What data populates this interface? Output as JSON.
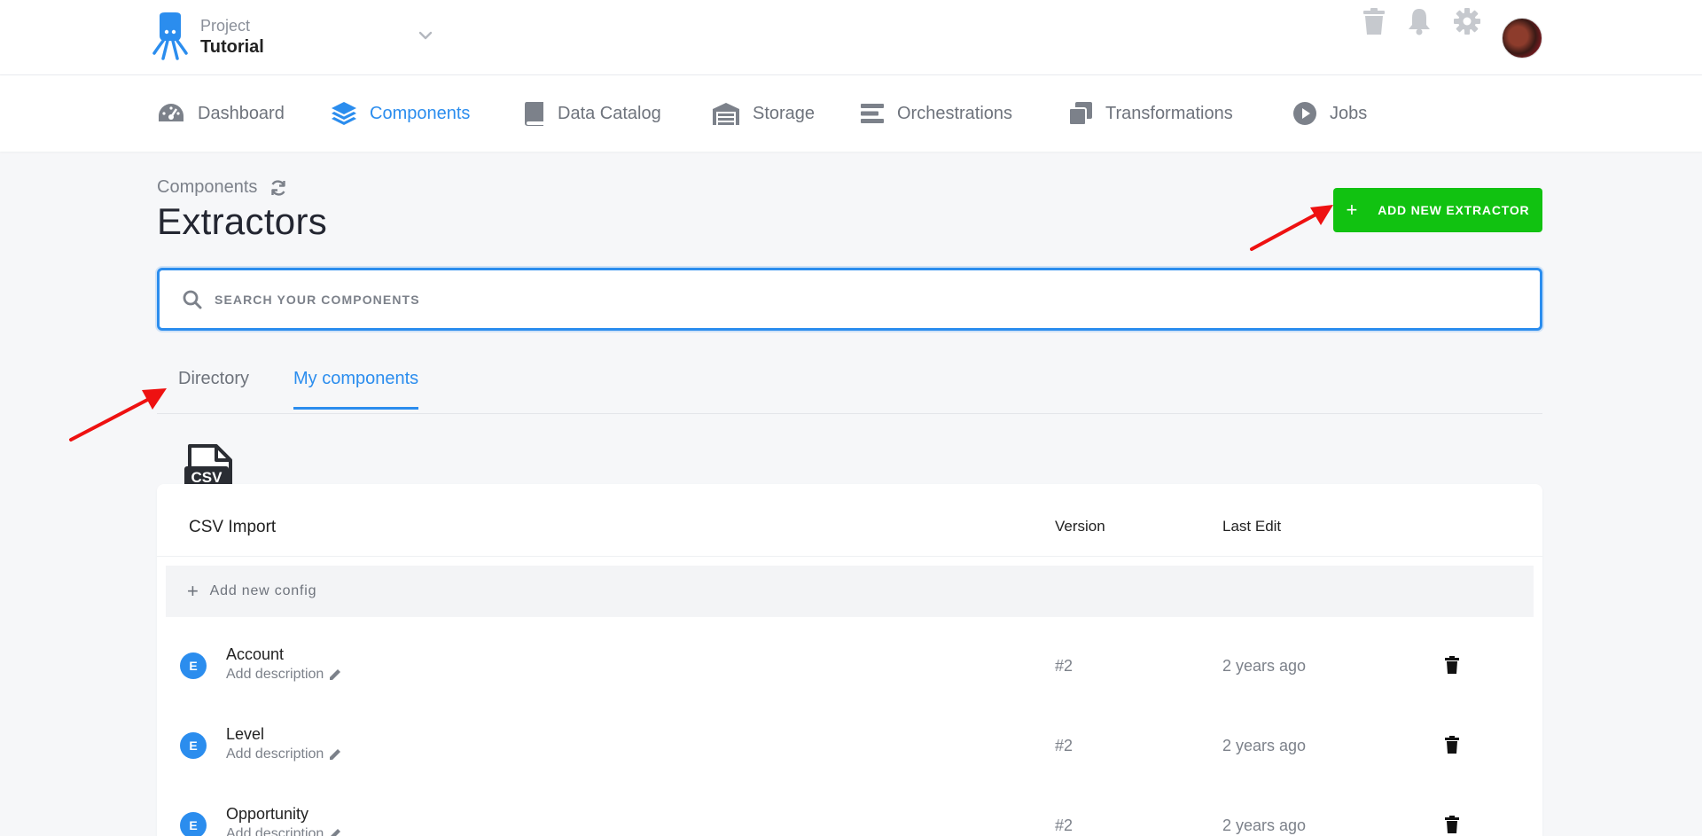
{
  "header": {
    "project_label": "Project",
    "project_name": "Tutorial"
  },
  "nav": [
    {
      "label": "Dashboard",
      "icon": "dashboard-icon",
      "active": false
    },
    {
      "label": "Components",
      "icon": "layers-icon",
      "active": true
    },
    {
      "label": "Data Catalog",
      "icon": "book-icon",
      "active": false
    },
    {
      "label": "Storage",
      "icon": "warehouse-icon",
      "active": false
    },
    {
      "label": "Orchestrations",
      "icon": "bars-icon",
      "active": false
    },
    {
      "label": "Transformations",
      "icon": "copy-icon",
      "active": false
    },
    {
      "label": "Jobs",
      "icon": "play-circle-icon",
      "active": false
    }
  ],
  "page": {
    "breadcrumb": "Components",
    "title": "Extractors",
    "add_button": "ADD NEW EXTRACTOR"
  },
  "search": {
    "placeholder": "SEARCH YOUR COMPONENTS",
    "value": ""
  },
  "tabs": [
    {
      "label": "Directory",
      "active": false
    },
    {
      "label": "My components",
      "active": true
    }
  ],
  "component": {
    "icon_text": "CSV",
    "name": "CSV Import",
    "col_version": "Version",
    "col_last_edit": "Last Edit",
    "add_config": "Add new config",
    "configs": [
      {
        "badge": "E",
        "name": "Account",
        "description": "Add description",
        "version": "#2",
        "last_edit": "2 years ago"
      },
      {
        "badge": "E",
        "name": "Level",
        "description": "Add description",
        "version": "#2",
        "last_edit": "2 years ago"
      },
      {
        "badge": "E",
        "name": "Opportunity",
        "description": "Add description",
        "version": "#2",
        "last_edit": "2 years ago"
      }
    ]
  },
  "colors": {
    "accent": "#2b8dee",
    "success": "#11c211",
    "annotation_arrow": "#ee1111"
  }
}
